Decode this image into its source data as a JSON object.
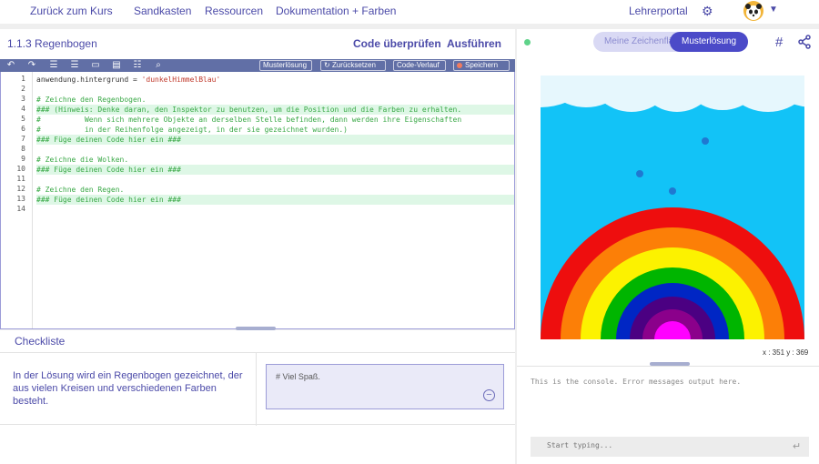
{
  "nav": {
    "back": "Zurück zum Kurs",
    "sandbox": "Sandkasten",
    "resources": "Ressourcen",
    "docs": "Dokumentation + Farben",
    "teacher": "Lehrerportal"
  },
  "exercise": {
    "title": "1.1.3 Regenbogen",
    "check_label": "Code überprüfen",
    "run_label": "Ausführen"
  },
  "toolbar": {
    "icons": [
      "undo-icon",
      "redo-icon",
      "indent-icon",
      "comment-icon",
      "docs-icon",
      "outdent-icon",
      "search-icon"
    ],
    "solution": "Musterlösung",
    "reset": "Zurücksetzen",
    "history": "Code-Verlauf",
    "save": "Speichern"
  },
  "code_lines": [
    {
      "n": "1",
      "text": "anwendung.hintergrund = ",
      "str": "'dunkelHimmelBlau'",
      "hl": false,
      "cm": false
    },
    {
      "n": "2",
      "text": "",
      "str": "",
      "hl": false,
      "cm": false
    },
    {
      "n": "3",
      "text": "# Zeichne den Regenbogen.",
      "str": "",
      "hl": false,
      "cm": true
    },
    {
      "n": "4",
      "text": "### (Hinweis: Denke daran, den Inspektor zu benutzen, um die Position und die Farben zu erhalten.",
      "str": "",
      "hl": true,
      "cm": true
    },
    {
      "n": "5",
      "text": "#          Wenn sich mehrere Objekte an derselben Stelle befinden, dann werden ihre Eigenschaften",
      "str": "",
      "hl": false,
      "cm": true
    },
    {
      "n": "6",
      "text": "#          in der Reihenfolge angezeigt, in der sie gezeichnet wurden.)",
      "str": "",
      "hl": false,
      "cm": true
    },
    {
      "n": "7",
      "text": "### Füge deinen Code hier ein ###",
      "str": "",
      "hl": true,
      "cm": true
    },
    {
      "n": "8",
      "text": "",
      "str": "",
      "hl": false,
      "cm": false
    },
    {
      "n": "9",
      "text": "# Zeichne die Wolken.",
      "str": "",
      "hl": false,
      "cm": true
    },
    {
      "n": "10",
      "text": "### Füge deinen Code hier ein ###",
      "str": "",
      "hl": true,
      "cm": true
    },
    {
      "n": "11",
      "text": "",
      "str": "",
      "hl": false,
      "cm": false
    },
    {
      "n": "12",
      "text": "# Zeichne den Regen.",
      "str": "",
      "hl": false,
      "cm": true
    },
    {
      "n": "13",
      "text": "### Füge deinen Code hier ein ###",
      "str": "",
      "hl": true,
      "cm": true
    },
    {
      "n": "14",
      "text": "",
      "str": "",
      "hl": false,
      "cm": false
    }
  ],
  "checklist": {
    "title": "Checkliste",
    "item": "In der Lösung wird ein Regenbogen gezeichnet, der aus vielen Kreisen und verschiedenen Farben besteht.",
    "note": "# Viel Spaß."
  },
  "preview": {
    "mine_label": "Meine Zeichenfläche",
    "solution_label": "Musterlösung",
    "coords": "x : 351 y : 369",
    "sky_color": "#12c3f7",
    "rainbow_colors": [
      "#ee0e0e",
      "#fc7f07",
      "#fcf200",
      "#00b500",
      "#0026c4",
      "#4b0082",
      "#8b008b",
      "#ff00ff"
    ],
    "rain_color": "#1f78d1"
  },
  "console": {
    "message": "This is the console. Error messages output here.",
    "placeholder": "Start typing..."
  }
}
